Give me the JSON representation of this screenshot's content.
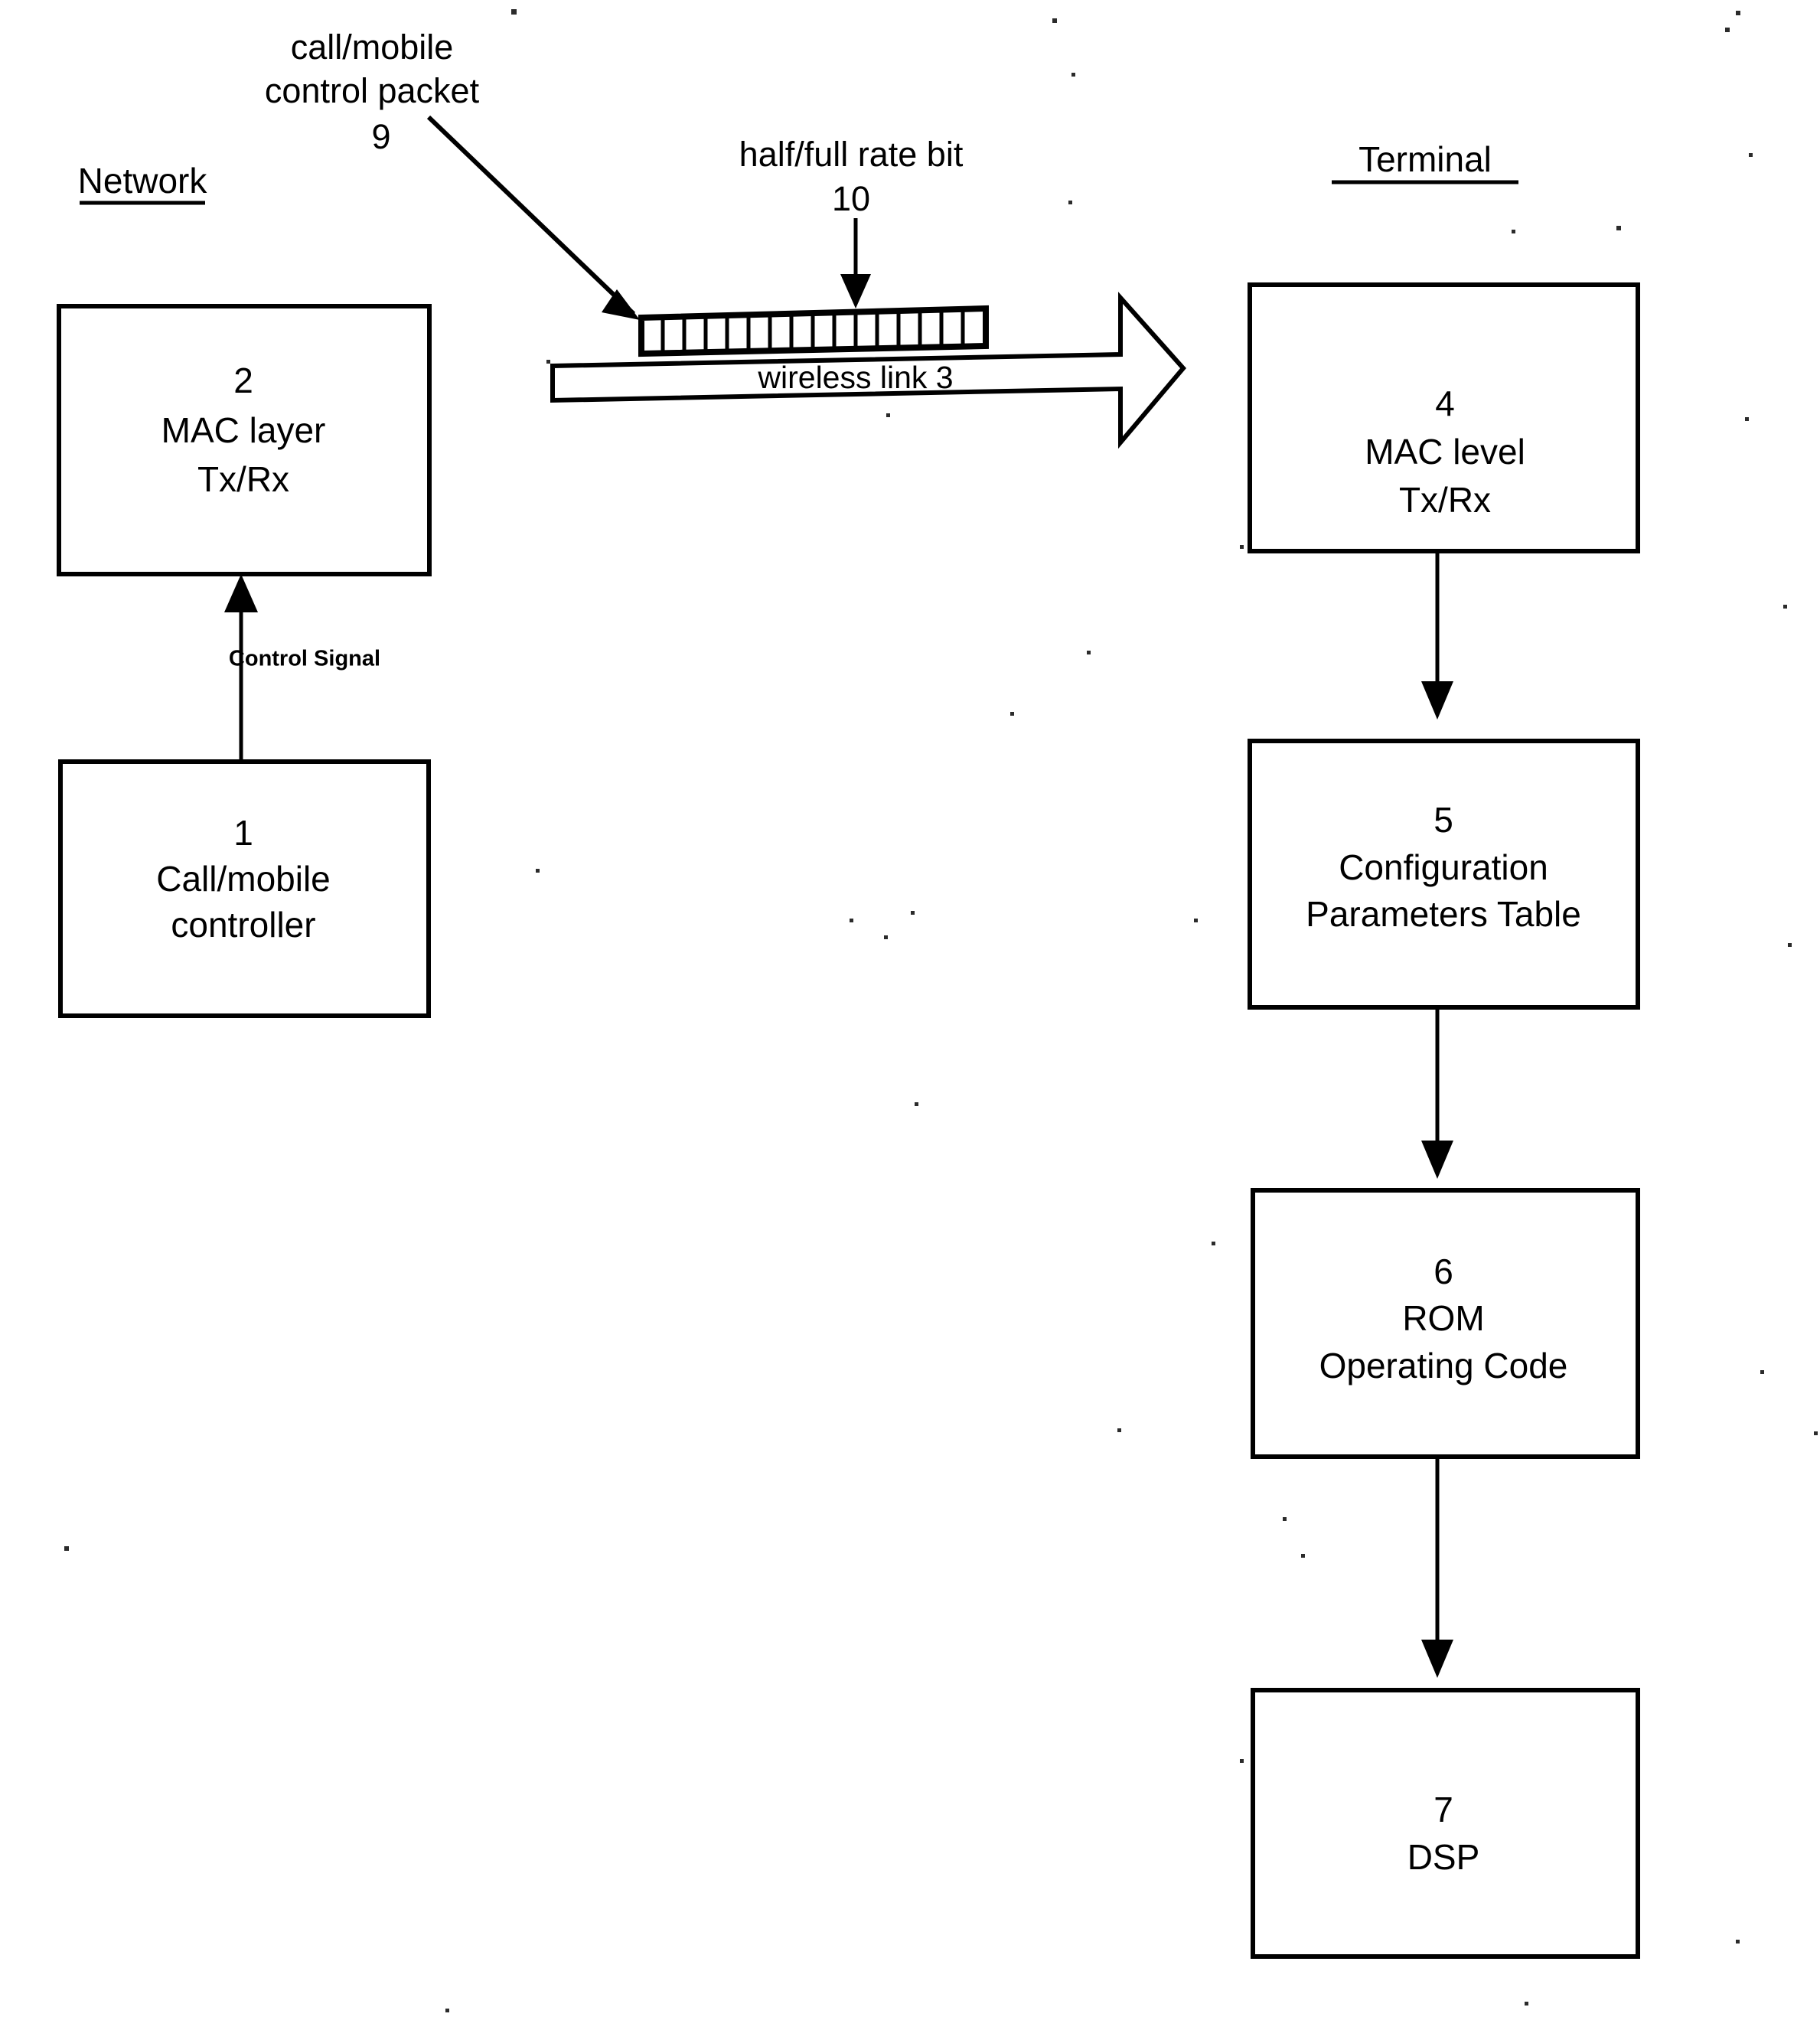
{
  "figure": {
    "type": "patent-block-diagram",
    "headings": {
      "network": "Network",
      "terminal": "Terminal"
    },
    "annotations": {
      "packet_label_line1": "call/mobile",
      "packet_label_line2": "control packet",
      "packet_ref": "9",
      "bit_label": "half/full rate bit",
      "bit_ref": "10",
      "wireless_link": "wireless link 3",
      "control_signal": "Control Signal"
    },
    "boxes": [
      {
        "id": "box-2",
        "ref": "2",
        "line1": "MAC layer",
        "line2": "Tx/Rx",
        "side": "network"
      },
      {
        "id": "box-1",
        "ref": "1",
        "line1": "Call/mobile",
        "line2": "controller",
        "side": "network"
      },
      {
        "id": "box-4",
        "ref": "4",
        "line1": "MAC level",
        "line2": "Tx/Rx",
        "side": "terminal"
      },
      {
        "id": "box-5",
        "ref": "5",
        "line1": "Configuration",
        "line2": "Parameters Table",
        "side": "terminal"
      },
      {
        "id": "box-6",
        "ref": "6",
        "line1": "ROM",
        "line2": "Operating Code",
        "side": "terminal"
      },
      {
        "id": "box-7",
        "ref": "7",
        "line1": "DSP",
        "line2": "",
        "side": "terminal"
      }
    ],
    "packet": {
      "cell_count": 16,
      "highlighted_cell_index": 11
    },
    "colors": {
      "ink": "#000000",
      "paper": "#ffffff"
    }
  }
}
